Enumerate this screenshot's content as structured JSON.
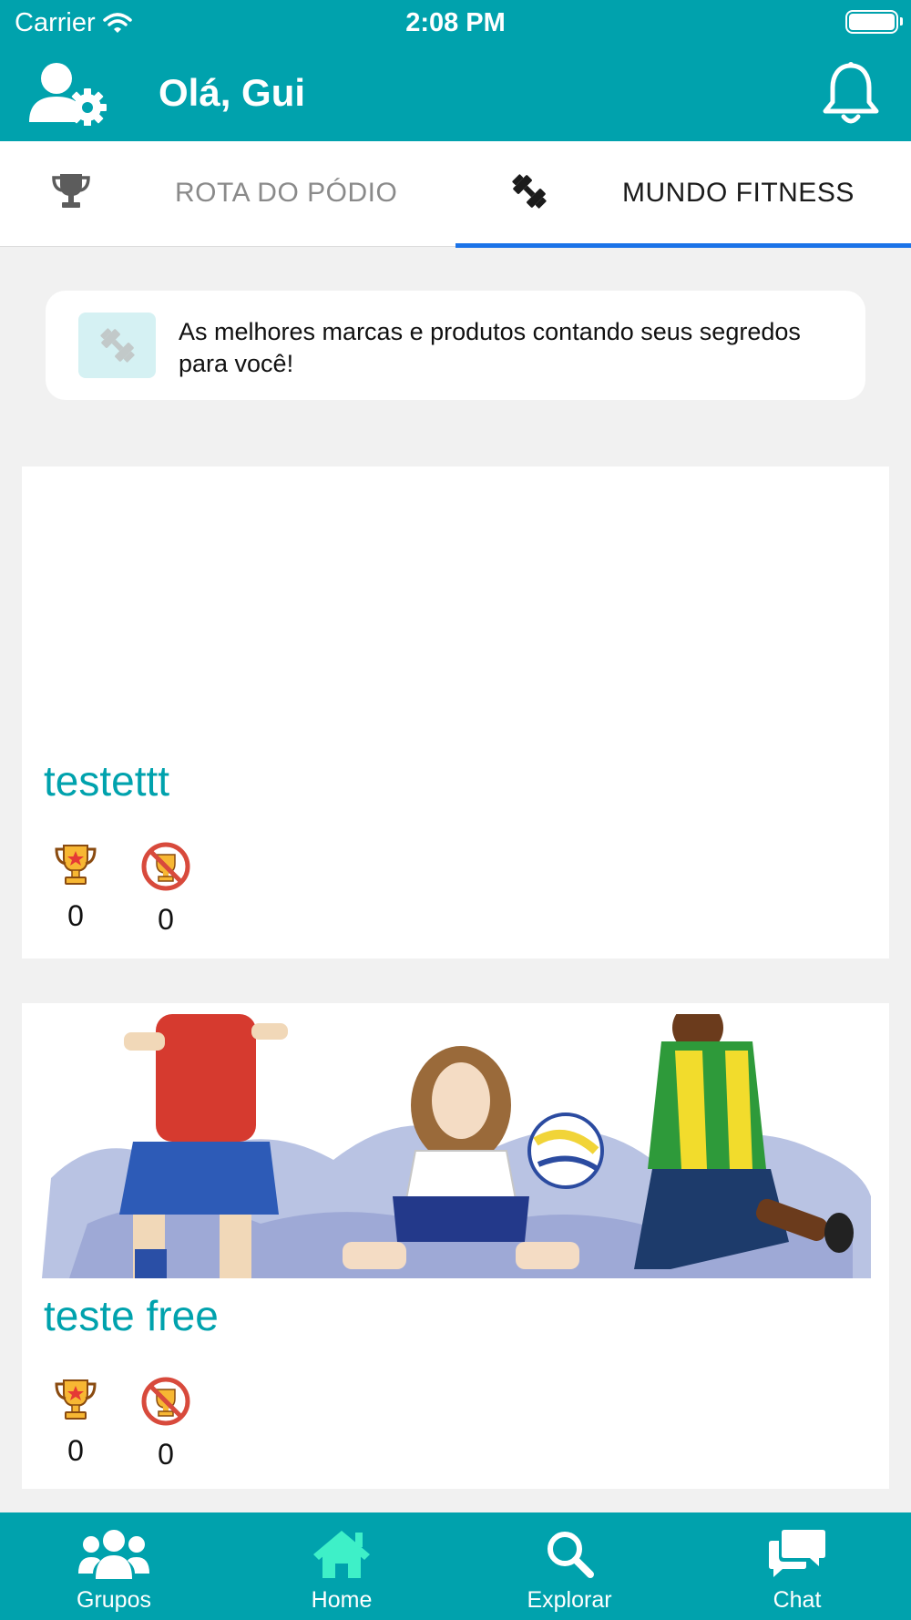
{
  "status_bar": {
    "carrier": "Carrier",
    "time": "2:08 PM"
  },
  "header": {
    "greeting": "Olá, Gui"
  },
  "tabs": [
    {
      "label": "ROTA DO PÓDIO",
      "icon": "trophy-icon",
      "selected": false
    },
    {
      "label": "MUNDO FITNESS",
      "icon": "dumbbell-icon",
      "selected": true
    }
  ],
  "info_banner": {
    "text": "As melhores marcas e produtos contando seus segredos para você!",
    "icon": "dumbbell-icon"
  },
  "groups": [
    {
      "title": "testettt",
      "wins": "0",
      "losses": "0",
      "has_image": false
    },
    {
      "title": "teste free",
      "wins": "0",
      "losses": "0",
      "has_image": true
    }
  ],
  "bottom_nav": [
    {
      "label": "Grupos",
      "icon": "users-icon"
    },
    {
      "label": "Home",
      "icon": "home-icon",
      "active": true
    },
    {
      "label": "Explorar",
      "icon": "search-icon"
    },
    {
      "label": "Chat",
      "icon": "chat-icon"
    }
  ],
  "colors": {
    "primary": "#00a2ad",
    "tab_indicator": "#1b73e8",
    "active_nav": "#3ef0c8",
    "background": "#f1f1f1"
  }
}
